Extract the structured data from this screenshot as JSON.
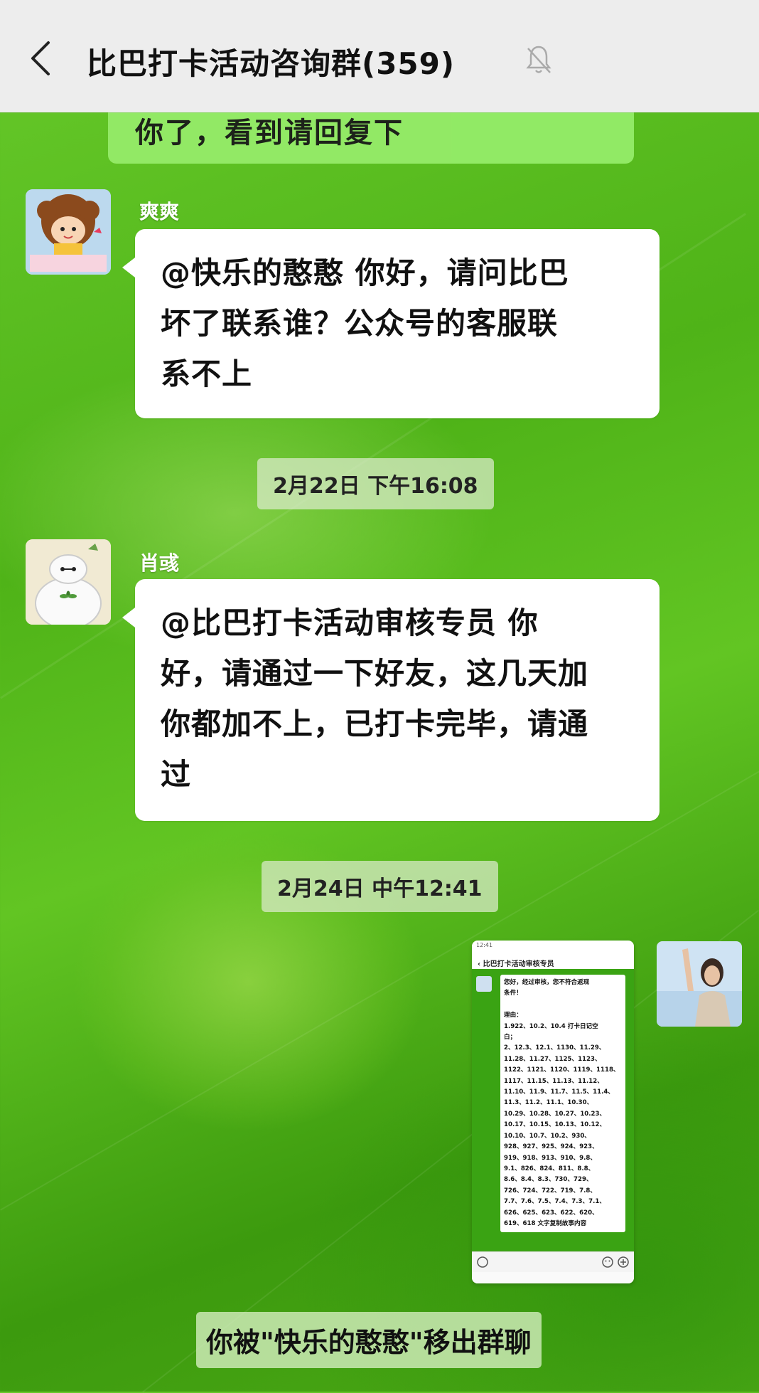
{
  "header": {
    "title": "比巴打卡活动咨询群(359)",
    "back_icon": "chevron-left-icon",
    "mute_icon": "bell-off-icon"
  },
  "messages": {
    "partial_own": {
      "text": "你了，看到请回复下"
    },
    "msg1": {
      "sender": "爽爽",
      "text": "@快乐的憨憨  你好，请问比巴坏了联系谁？公众号的客服联系不上",
      "lines": [
        "@快乐的憨憨  你好，请问比巴",
        "坏了联系谁？公众号的客服联",
        "系不上"
      ]
    },
    "time1": "2月22日 下午16:08",
    "msg2": {
      "sender": "肖彧",
      "lines": [
        "@比巴打卡活动审核专员  你",
        "好，请通过一下好友，这几天加",
        "你都加不上，已打卡完毕，请通",
        "过"
      ]
    },
    "time2": "2月24日 中午12:41",
    "screenshot": {
      "status_time": "12:41",
      "nav_title": "比巴打卡活动审核专员",
      "lines": [
        "您好，经过审核，您不符合返现",
        "条件！",
        "",
        "理由：",
        "1.922、10.2、10.4 打卡日记空",
        "白；",
        "2、12.3、12.1、1130、11.29、",
        "11.28、11.27、1125、1123、",
        "1122、1121、1120、1119、1118、",
        "1117、11.15、11.13、11.12、",
        "11.10、11.9、11.7、11.5、11.4、",
        "11.3、11.2、11.1、10.30、",
        "10.29、10.28、10.27、10.23、",
        "10.17、10.15、10.13、10.12、",
        "10.10、10.7、10.2、930、",
        "928、927、925、924、923、",
        "919、918、913、910、9.8、",
        "9.1、826、824、811、8.8、",
        "8.6、8.4、8.3、730、729、",
        "726、724、722、719、7.8、",
        "7.7、7.6、7.5、7.4、7.3、7.1、",
        "626、625、623、622、620、",
        "619、618 文字复制故事内容"
      ]
    },
    "system": "你被\"快乐的憨憨\"移出群聊"
  },
  "colors": {
    "own_bubble": "#95ec69",
    "bubble": "#ffffff",
    "header_bg": "#ededed"
  }
}
